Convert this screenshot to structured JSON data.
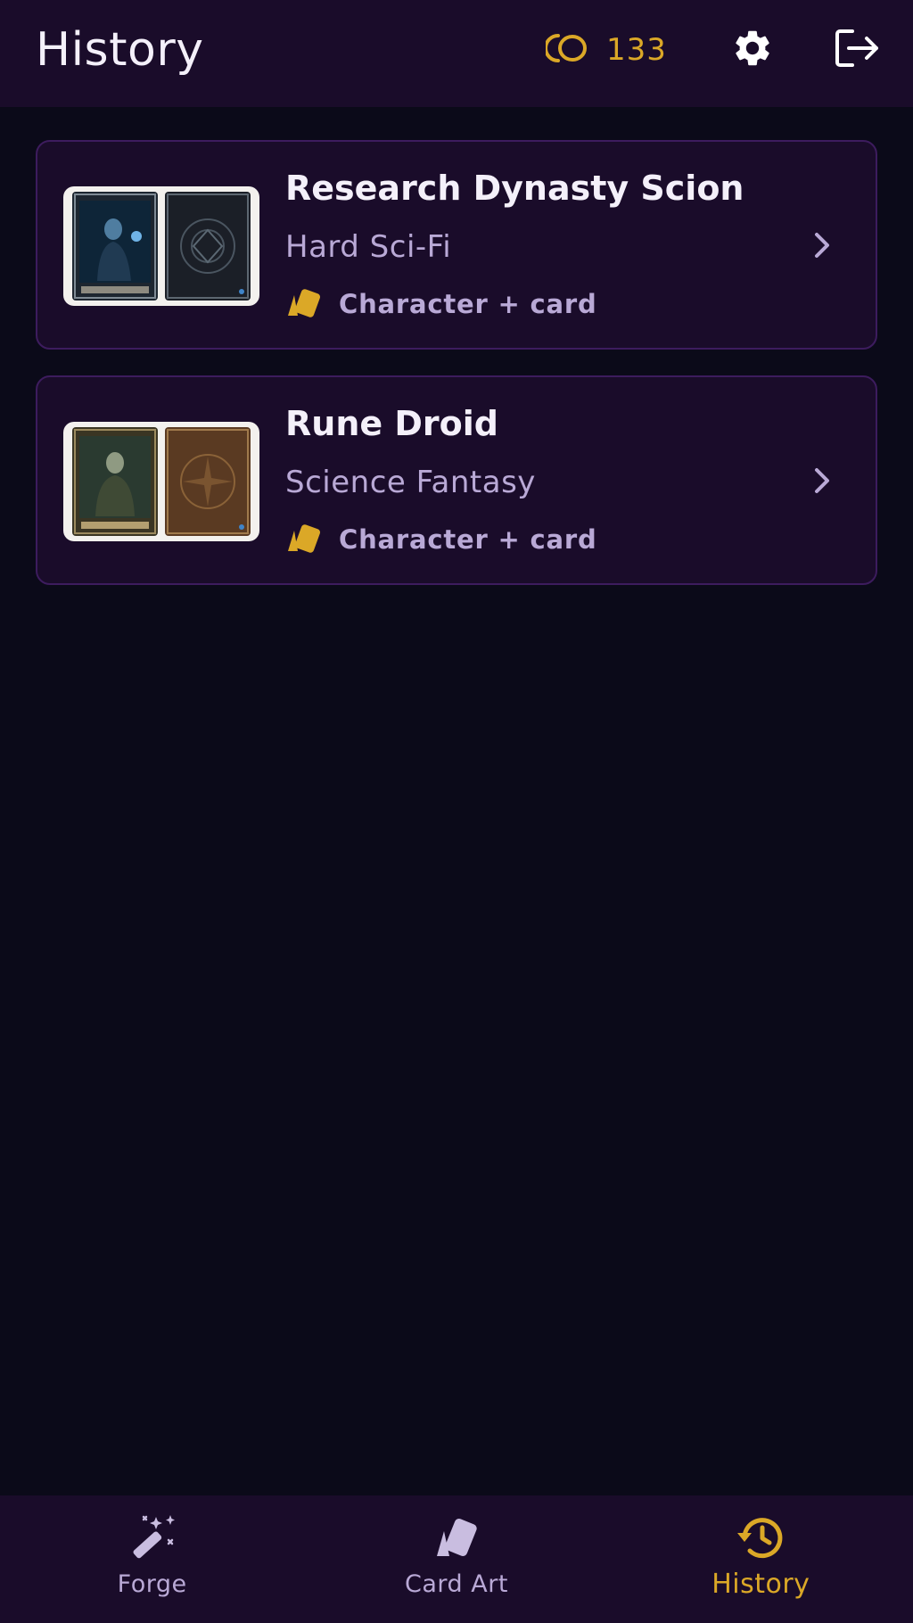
{
  "header": {
    "title": "History",
    "credits": "133",
    "credits_icon": "coins-icon",
    "settings_icon": "gear-icon",
    "logout_icon": "logout-icon"
  },
  "history": [
    {
      "title": "Research Dynasty Scion",
      "genre": "Hard Sci-Fi",
      "type": "Character + card",
      "type_icon": "cards-icon"
    },
    {
      "title": "Rune Droid",
      "genre": "Science Fantasy",
      "type": "Character + card",
      "type_icon": "cards-icon"
    }
  ],
  "nav": {
    "items": [
      {
        "label": "Forge",
        "icon": "magic-wand-icon"
      },
      {
        "label": "Card Art",
        "icon": "cards-icon"
      },
      {
        "label": "History",
        "icon": "history-icon",
        "active": true
      }
    ]
  },
  "colors": {
    "accent": "#dba827",
    "background": "#0b0a19",
    "surface": "#1a0c2a",
    "muted_text": "#b9a9d6",
    "card_border": "#3d1c5e"
  }
}
